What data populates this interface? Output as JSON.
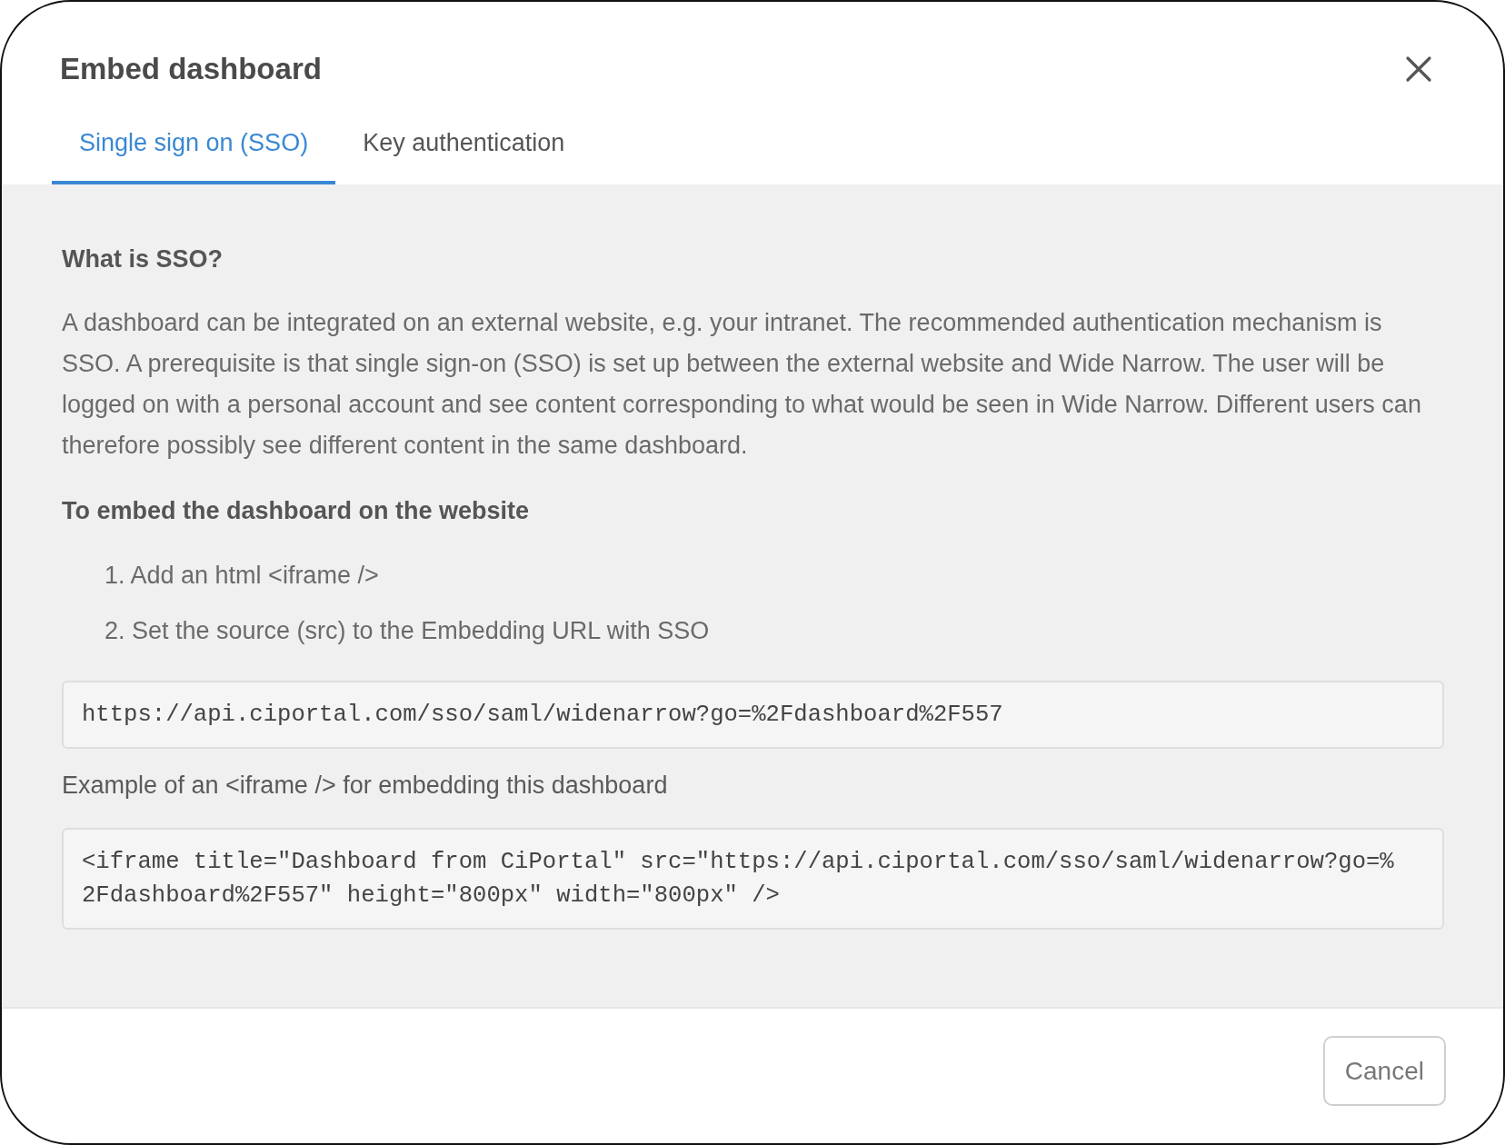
{
  "dialog": {
    "title": "Embed dashboard"
  },
  "tabs": [
    {
      "label": "Single sign on (SSO)",
      "selected": true
    },
    {
      "label": "Key authentication",
      "selected": false
    }
  ],
  "content": {
    "heading": "What is SSO?",
    "description": "A dashboard can be integrated on an external website, e.g. your intranet. The recommended authentication mechanism is SSO. A prerequisite is that single sign-on (SSO) is set up between the external website and Wide Narrow. The user will be logged on with a personal account and see content corresponding to what would be seen in Wide Narrow. Different users can therefore possibly see different content in the same dashboard.",
    "steps_heading": "To embed the dashboard on the website",
    "steps": [
      "1. Add an html <iframe />",
      "2. Set the source (src) to the Embedding URL with SSO"
    ],
    "embedding_url": "https://api.ciportal.com/sso/saml/widenarrow?go=%2Fdashboard%2F557",
    "example_heading": "Example of an <iframe /> for embedding this dashboard",
    "example_code": "<iframe title=\"Dashboard from CiPortal\" src=\"https://api.ciportal.com/sso/saml/widenarrow?go=%2Fdashboard%2F557\" height=\"800px\" width=\"800px\" />"
  },
  "buttons": [
    "Cancel"
  ]
}
